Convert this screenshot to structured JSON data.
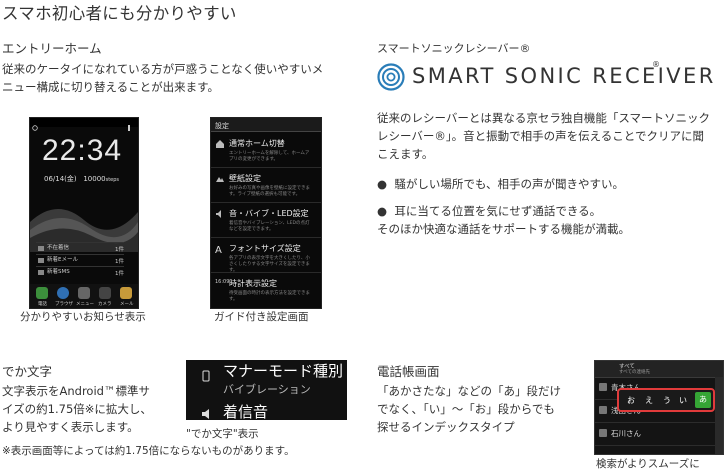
{
  "page_title": "スマホ初心者にも分かりやすい",
  "entry_home": {
    "title": "エントリーホーム",
    "body": [
      "従来のケータイになれている方が戸惑うことなく使いやすいメ",
      "ニュー構成に切り替えることが出来ます。"
    ],
    "caption_left": "分かりやすいお知らせ表示",
    "caption_right": "ガイド付き設定画面",
    "home_screen": {
      "clock": "22:34",
      "date": "06/14(金)",
      "steps": "10000",
      "steps_unit": "steps",
      "notifications": [
        {
          "label": "不在着信",
          "count": "1件"
        },
        {
          "label": "新着Eメール",
          "count": "1件"
        },
        {
          "label": "新着SMS",
          "count": "1件"
        }
      ],
      "dock": [
        "電話",
        "ブラウザ",
        "メニュー",
        "カメラ",
        "メール"
      ]
    },
    "settings_screen": {
      "header": "設定",
      "items": [
        {
          "title": "通常ホーム切替",
          "desc": "エントリーホームを解除して、ホームアプリの変更ができます。"
        },
        {
          "title": "壁紙設定",
          "desc": "お好みの写真や画像を壁紙に設定できます。ライブ壁紙の選択も可能です。"
        },
        {
          "title": "音・バイブ・LED設定",
          "desc": "着信音やバイブレーション、LEDの点灯などを設定できます。"
        },
        {
          "title": "フォントサイズ設定",
          "desc": "各アプリの表示文字を大きくしたり、小さくしたりする文字サイズを設定できます。"
        },
        {
          "title": "時計表示設定",
          "desc": "待受画面の時計の表示方法を設定できます。"
        }
      ],
      "time_label": "16:09"
    }
  },
  "sonic": {
    "title": "スマートソニックレシーバー®",
    "logo_text": "SMART SONIC RECEIVER",
    "logo_reg": "®",
    "body": [
      "従来のレシーバーとは異なる京セラ独自機能「スマートソニック",
      "レシーバー®」。音と振動で相手の声を伝えることでクリアに聞",
      "こえます。"
    ],
    "bullets": [
      "騒がしい場所でも、相手の声が聞きやすい。",
      "耳に当てる位置を気にせず通話できる。"
    ],
    "note": "そのほか快適な通話をサポートする機能が満載。"
  },
  "dekamoji": {
    "title": "でか文字",
    "body": [
      "文字表示をAndroid™標準サ",
      "イズの約1.75倍※に拡大し、",
      "より見やすく表示します。"
    ],
    "caption": "\"でか文字\"表示",
    "footnote": "※表示画面等によっては約1.75倍にならないものがあります。",
    "screen_lines": [
      "マナーモード種別",
      "バイブレーション",
      "着信音"
    ]
  },
  "phonebook": {
    "title": "電話帳画面",
    "body": [
      "「あかさたな」などの「あ」段だけ",
      "でなく、「い」～「お」段からでも",
      "探せるインデックスタイプ"
    ],
    "caption": "検索がよりスムーズに",
    "screen": {
      "header_main": "すべて",
      "header_sub": "すべての連絡先",
      "rows": [
        "青木さん",
        "浅田さん",
        "石川さん"
      ],
      "index_kana": [
        "お",
        "え",
        "う",
        "い"
      ],
      "index_active": "あ"
    }
  },
  "colors": {
    "index_highlight": "#e13b3b",
    "index_active_bg": "#35a535"
  }
}
